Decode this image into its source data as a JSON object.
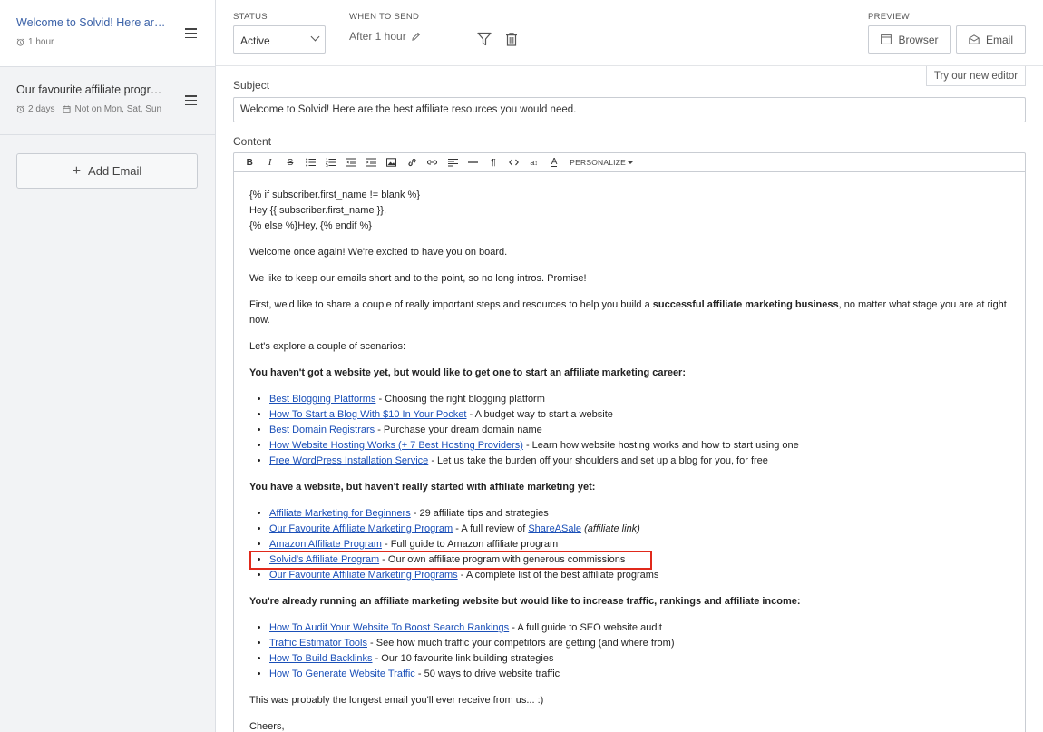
{
  "sidebar": {
    "items": [
      {
        "title": "Welcome to Solvid! Here are the best affiliate resources you would need.",
        "delay": "1 hour",
        "restriction": ""
      },
      {
        "title": "Our favourite affiliate programs",
        "delay": "2 days",
        "restriction": "Not on Mon, Sat, Sun"
      }
    ],
    "add_email_label": "Add Email"
  },
  "topbar": {
    "status_label": "STATUS",
    "status_value": "Active",
    "when_label": "WHEN TO SEND",
    "when_value": "After 1 hour",
    "preview_label": "PREVIEW",
    "browser_label": "Browser",
    "email_label": "Email",
    "new_editor_label": "Try our new editor"
  },
  "form": {
    "subject_label": "Subject",
    "subject_value": "Welcome to Solvid! Here are the best affiliate resources you would need.",
    "content_label": "Content",
    "personalize_label": "PERSONALIZE"
  },
  "toolbar_icons": [
    "bold-icon",
    "italic-icon",
    "strikethrough-icon",
    "bullet-list-icon",
    "numbered-list-icon",
    "outdent-icon",
    "indent-icon",
    "image-icon",
    "link-icon",
    "unlink-icon",
    "align-icon",
    "horizontal-rule-icon",
    "paragraph-icon",
    "code-icon",
    "font-size-icon",
    "font-color-icon"
  ],
  "email": {
    "liquid1": "{% if subscriber.first_name != blank %}",
    "liquid2": "Hey {{ subscriber.first_name }},",
    "liquid3": "{% else %}Hey, {% endif %}",
    "p1": "Welcome once again! We're excited to have you on board.",
    "p2": "We like to keep our emails short and to the point, so no long intros. Promise!",
    "p3a": "First, we'd like to share a couple of really important steps and resources to help you build a ",
    "p3b": "successful affiliate marketing business",
    "p3c": ", no matter what stage you are at right now.",
    "p4": "Let's explore a couple of scenarios:",
    "h1": "You haven't got a website yet, but would like to get one to start an affiliate marketing career:",
    "list1": [
      {
        "link": "Best Blogging Platforms",
        "text": " - Choosing the right blogging platform"
      },
      {
        "link": "How To Start a Blog With $10 In Your Pocket",
        "text": " - A budget way to start a website"
      },
      {
        "link": "Best Domain Registrars",
        "text": " - Purchase your dream domain name"
      },
      {
        "link": "How Website Hosting Works (+ 7 Best Hosting Providers)",
        "text": " - Learn how website hosting works and how to start using one"
      },
      {
        "link": "Free WordPress Installation Service",
        "text": " - Let us take the burden off your shoulders and set up a blog for you, for free"
      }
    ],
    "h2": "You have a website, but haven't really started with affiliate marketing yet:",
    "list2": [
      {
        "link": "Affiliate Marketing for Beginners",
        "text": " - 29 affiliate tips and strategies"
      },
      {
        "link": "Our Favourite Affiliate Marketing Program",
        "text": " - A full review of ",
        "link2": "ShareASale",
        "italic": "(affiliate link)"
      },
      {
        "link": "Amazon Affiliate Program",
        "text": " - Full guide to Amazon affiliate program"
      },
      {
        "link": "Solvid's Affiliate Program",
        "text": " - Our own affiliate program with generous commissions"
      },
      {
        "link": "Our Favourite Affiliate Marketing Programs",
        "text": " - A complete list of the best affiliate programs"
      }
    ],
    "h3": "You're already running an affiliate marketing website but would like to increase traffic, rankings and affiliate income:",
    "list3": [
      {
        "link": "How To Audit Your Website To Boost Search Rankings",
        "text": " - A full guide to SEO website audit"
      },
      {
        "link": "Traffic Estimator Tools",
        "text": " - See how much traffic your competitors are getting (and where from)"
      },
      {
        "link": "How To Build Backlinks",
        "text": " - Our 10 favourite link building strategies"
      },
      {
        "link": "How To Generate Website Traffic",
        "text": " - 50 ways to drive website traffic"
      }
    ],
    "p5": "This was probably the longest email you'll ever receive from us... :)",
    "p6": "Cheers,"
  }
}
